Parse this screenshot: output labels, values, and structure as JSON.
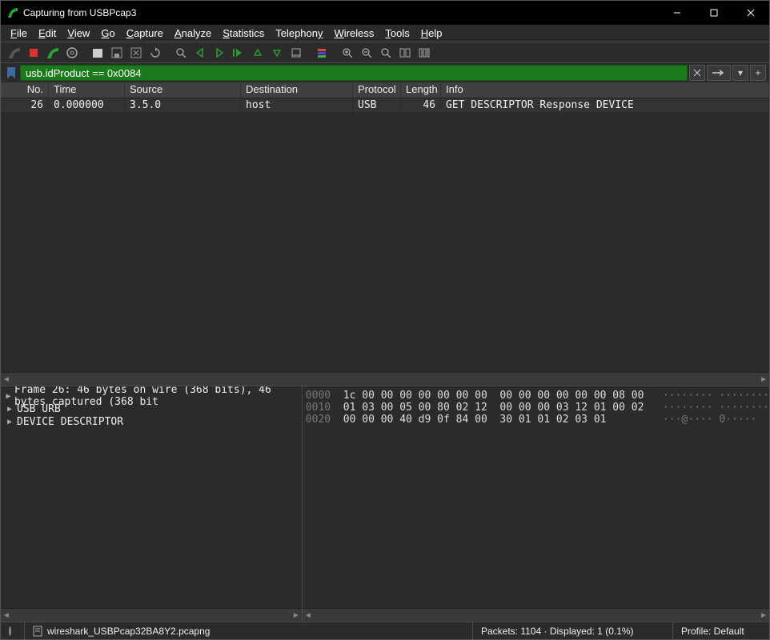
{
  "window": {
    "title": "Capturing from USBPcap3"
  },
  "menu": [
    "File",
    "Edit",
    "View",
    "Go",
    "Capture",
    "Analyze",
    "Statistics",
    "Telephony",
    "Wireless",
    "Tools",
    "Help"
  ],
  "filter": {
    "value": "usb.idProduct == 0x0084"
  },
  "columns": {
    "no": "No.",
    "time": "Time",
    "source": "Source",
    "destination": "Destination",
    "protocol": "Protocol",
    "length": "Length",
    "info": "Info"
  },
  "rows": [
    {
      "no": "26",
      "time": "0.000000",
      "source": "3.5.0",
      "destination": "host",
      "protocol": "USB",
      "length": "46",
      "info": "GET DESCRIPTOR Response DEVICE"
    }
  ],
  "tree": [
    "Frame 26: 46 bytes on wire (368 bits), 46 bytes captured (368 bit",
    "USB URB",
    "DEVICE DESCRIPTOR"
  ],
  "hex": {
    "lines": [
      {
        "off": "0000",
        "hex": "1c 00 00 00 00 00 00 00  00 00 00 00 00 00 08 00",
        "asc": "········ ········"
      },
      {
        "off": "0010",
        "hex": "01 03 00 05 00 80 02 12  00 00 00 03 12 01 00 02",
        "asc": "········ ········"
      },
      {
        "off": "0020",
        "hex": "00 00 00 40 d9 0f 84 00  30 01 01 02 03 01      ",
        "asc": "···@···· 0·····  "
      }
    ]
  },
  "status": {
    "file": "wireshark_USBPcap32BA8Y2.pcapng",
    "packets": "Packets: 1104 · Displayed: 1 (0.1%)",
    "profile": "Profile: Default"
  }
}
